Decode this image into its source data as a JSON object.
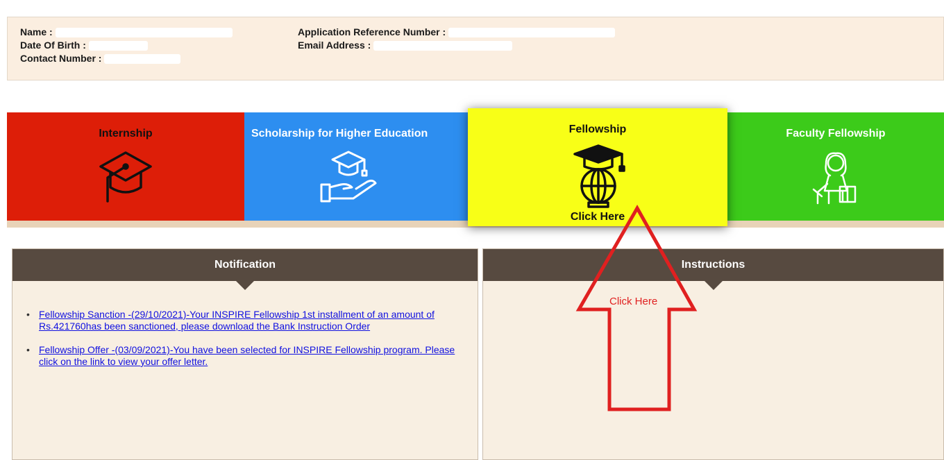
{
  "profile": {
    "name_label": "Name :",
    "dob_label": "Date Of Birth :",
    "contact_label": "Contact Number :",
    "app_ref_label": "Application Reference Number :",
    "email_label": "Email Address :"
  },
  "tiles": [
    {
      "title": "Internship",
      "icon": "graduation-cap-icon",
      "color": "#dd1e08"
    },
    {
      "title": "Scholarship for Higher Education",
      "icon": "scholarship-hand-icon",
      "color": "#2d8ef0"
    },
    {
      "title": "Fellowship",
      "icon": "globe-cap-icon",
      "color": "#f8ff17",
      "cta": "Click Here"
    },
    {
      "title": "Faculty Fellowship",
      "icon": "teacher-icon",
      "color": "#3ccb1a"
    }
  ],
  "notification": {
    "title": "Notification",
    "items": [
      "Fellowship Sanction -(29/10/2021)-Your INSPIRE Fellowship 1st installment of an amount of Rs.421760has been sanctioned, please download the Bank Instruction Order",
      "Fellowship Offer -(03/09/2021)-You have been selected for INSPIRE Fellowship program. Please click on the link to view your offer letter."
    ]
  },
  "instructions": {
    "title": "Instructions"
  },
  "annotation": {
    "label": "Click Here",
    "color": "#e02020"
  }
}
